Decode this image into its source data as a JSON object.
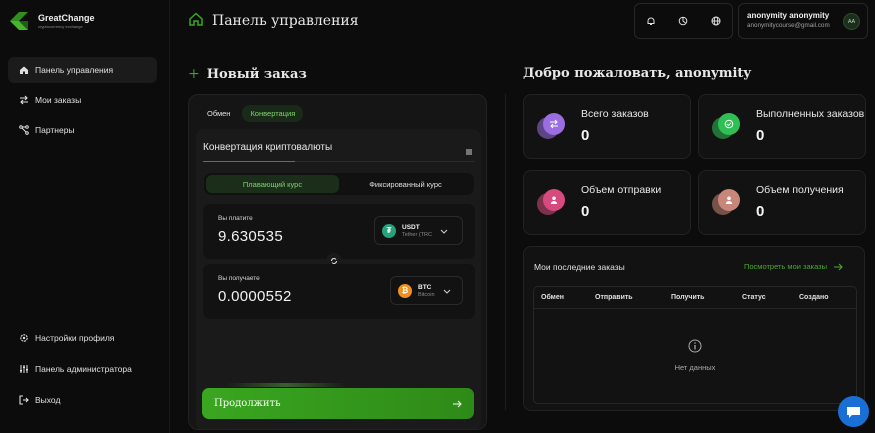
{
  "brand": {
    "name": "GreatChange",
    "tagline": "cryptocurrency exchange"
  },
  "sidebar": {
    "items": [
      {
        "label": "Панель управления",
        "icon": "home-icon",
        "active": true
      },
      {
        "label": "Мои заказы",
        "icon": "swap-icon"
      },
      {
        "label": "Партнеры",
        "icon": "share-icon"
      }
    ],
    "bottom_items": [
      {
        "label": "Настройки профиля",
        "icon": "gear-icon"
      },
      {
        "label": "Панель администратора",
        "icon": "sliders-icon"
      },
      {
        "label": "Выход",
        "icon": "logout-icon"
      }
    ]
  },
  "header": {
    "title": "Панель управления",
    "icons": [
      "bell-icon",
      "moon-icon",
      "globe-icon"
    ],
    "user": {
      "name": "anonymity anonymity",
      "email": "anonymitycourse@gmail.com",
      "initials": "AA"
    }
  },
  "new_order": {
    "title": "Новый заказ",
    "tabs": [
      "Обмен",
      "Конвертация"
    ],
    "active_tab": "Конвертация",
    "converter_title": "Конвертация криптовалюты",
    "rate_options": [
      "Плавающий курс",
      "Фиксированный курс"
    ],
    "active_rate": "Плавающий курс",
    "pay": {
      "label": "Вы платите",
      "amount": "9.630535",
      "coin": "USDT",
      "network": "Tether (TRC"
    },
    "receive": {
      "label": "Вы получаете",
      "amount": "0.0000552",
      "coin": "BTC",
      "network": "Bitcoin"
    },
    "continue_label": "Продолжить"
  },
  "welcome": {
    "title": "Добро пожаловать, anonymity",
    "stats": [
      {
        "label": "Всего заказов",
        "value": "0",
        "color": "#9a6ee0"
      },
      {
        "label": "Выполненных заказов",
        "value": "0",
        "color": "#2fbf54"
      },
      {
        "label": "Объем отправки",
        "value": "0",
        "color": "#d64a7e"
      },
      {
        "label": "Объем получения",
        "value": "0",
        "color": "#c9867a"
      }
    ]
  },
  "recent_orders": {
    "title": "Мои последние заказы",
    "link": "Посмотреть мои заказы",
    "columns": [
      "Обмен",
      "Отправить",
      "Получить",
      "Статус",
      "Создано"
    ],
    "empty_text": "Нет данных"
  },
  "colors": {
    "accent": "#3aa620",
    "background": "#0c0c0c",
    "card": "#121212",
    "chat": "#1a6fd6"
  }
}
